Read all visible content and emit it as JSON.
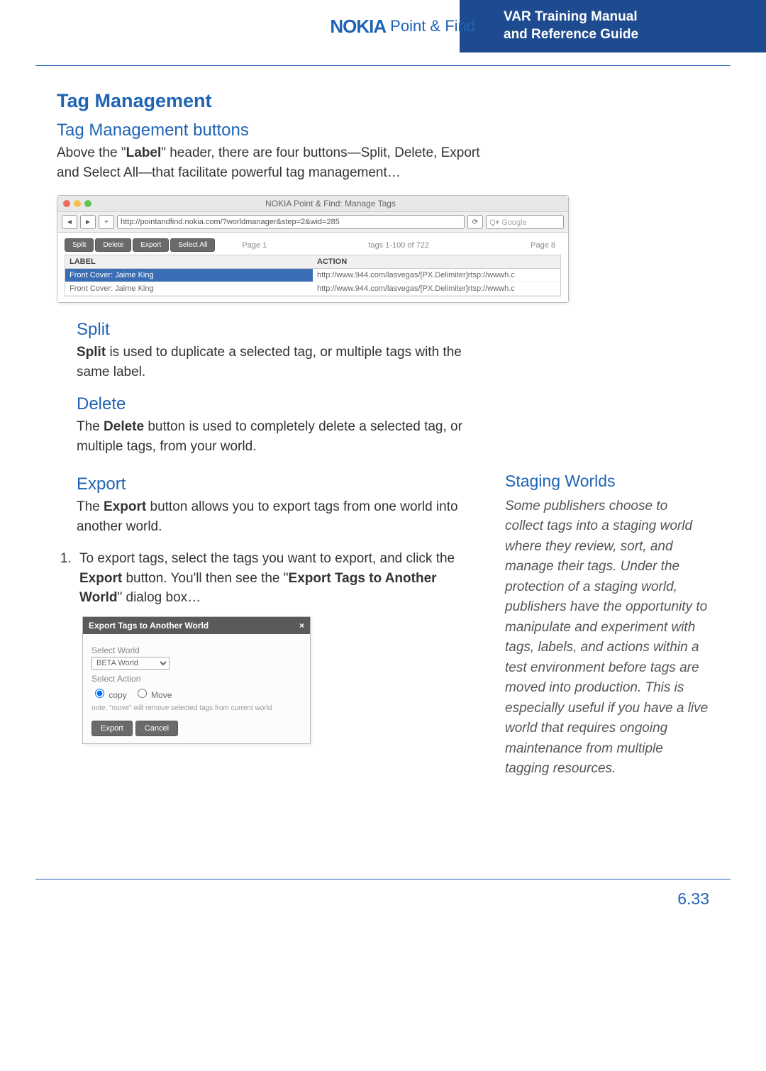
{
  "header": {
    "brand_logo": "NOKIA",
    "brand_product": "Point & Find",
    "doc_title_line1": "VAR Training Manual",
    "doc_title_line2": "and Reference Guide"
  },
  "section_heading": "Tag Management",
  "sub1_heading": "Tag Management buttons",
  "sub1_para_a": "Above the \"",
  "sub1_para_bold": "Label",
  "sub1_para_b": "\" header, there are four buttons—Split, Delete, Export and Select All—that facilitate powerful tag management…",
  "shot1": {
    "window_title": "NOKIA Point & Find: Manage Tags",
    "url": "http://pointandfind.nokia.com/?worldmanager&step=2&wid=285",
    "search_placeholder": "Q▾ Google",
    "buttons": {
      "split": "Split",
      "delete": "Delete",
      "export": "Export",
      "select_all": "Select All"
    },
    "pager": {
      "left": "Page 1",
      "center": "tags 1-100 of 722",
      "right": "Page 8"
    },
    "headers": {
      "label": "LABEL",
      "action": "ACTION"
    },
    "rows": [
      {
        "label": "Front Cover: Jaime King",
        "action": "http://www.944.com/lasvegas/[PX.Delimiter]rtsp://wwwh.c"
      },
      {
        "label": "Front Cover: Jaime King",
        "action": "http://www.944.com/lasvegas/[PX.Delimiter]rtsp://wwwh.c"
      }
    ]
  },
  "split_heading": "Split",
  "split_bold": "Split",
  "split_text": " is used to duplicate a selected tag, or multiple tags with the same label.",
  "delete_heading": "Delete",
  "delete_pre": "The ",
  "delete_bold": "Delete",
  "delete_text": " button is used to completely delete a selected tag, or multiple tags, from your world.",
  "export_heading": "Export",
  "export_pre": "The ",
  "export_bold": "Export",
  "export_text": " button allows you to export tags from one world into another world.",
  "step1_a": "To export tags, select the tags you want to export, and click the ",
  "step1_b": "Export",
  "step1_c": " button.  You'll then see the \"",
  "step1_d": "Export Tags to Another World",
  "step1_e": "\" dialog box…",
  "shot2": {
    "title": "Export Tags to Another World",
    "select_world_label": "Select World",
    "world_option": "BETA World",
    "select_action_label": "Select Action",
    "radio_copy": "copy",
    "radio_move": "Move",
    "note": "note: \"move\" will remove selected tags from current world",
    "btn_export": "Export",
    "btn_cancel": "Cancel"
  },
  "side_heading": "Staging Worlds",
  "side_text": "Some publishers choose to collect tags into a staging world where they review, sort, and manage their tags. Under the protection of a staging world, publishers have the opportunity to manipulate and experiment with tags, labels, and actions within a test environment before tags are moved into production. This is especially useful if you have a live world that requires ongoing maintenance from multiple tagging resources.",
  "page_number": "6.33"
}
